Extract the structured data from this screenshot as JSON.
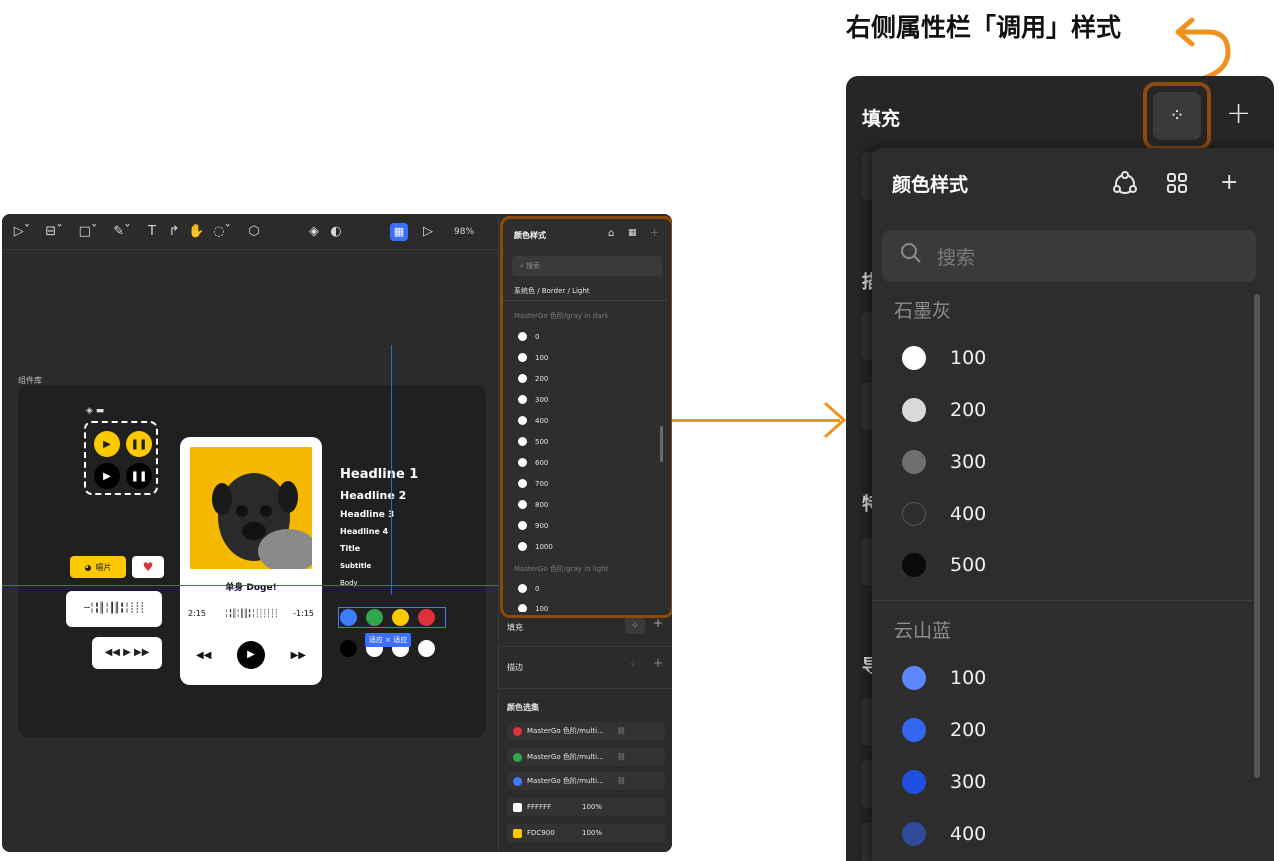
{
  "caption": {
    "text": "右侧属性栏「调用」样式"
  },
  "editor": {
    "toolbar": {
      "icons": [
        "cursor-icon",
        "frame-icon",
        "rect-icon",
        "pen-icon",
        "text-icon",
        "connector-icon",
        "hand-icon",
        "comment-icon",
        "plugin-icon",
        "component-icon",
        "contrast-icon",
        "grid-icon",
        "play-icon"
      ],
      "zoom": "98%"
    },
    "canvas": {
      "library_label": "组件库",
      "chip_label": "唱片",
      "song_title": "单身 Doge!",
      "time_start": "2:15",
      "time_end": "-1:15",
      "typography": [
        "Headline 1",
        "Headline 2",
        "Headline 3",
        "Headline 4",
        "Title",
        "Subtitle",
        "Body"
      ],
      "fit_tag": "适应 × 适应",
      "top_dots": [
        "#3d7bff",
        "#2ea84a",
        "#fdc900",
        "#e0303a"
      ],
      "bottom_dots": [
        "#000000",
        "#ffffff",
        "#ffffff",
        "#ffffff"
      ]
    },
    "popup": {
      "title": "颜色样式",
      "search_placeholder": "搜索",
      "category": "系统色 / Border / Light",
      "group1": "MasterGo 色阶/gray in dark",
      "items": [
        "0",
        "100",
        "200",
        "300",
        "400",
        "500",
        "600",
        "700",
        "800",
        "900",
        "1000"
      ],
      "group2": "MasterGo 色阶/gray in light",
      "items2": [
        "0",
        "100"
      ]
    },
    "panel": {
      "fill_label": "填充",
      "stroke_label": "描边",
      "selection_colors_label": "颜色选集",
      "styles": [
        {
          "name": "MasterGo 色阶/multi...",
          "color": "#e0303a"
        },
        {
          "name": "MasterGo 色阶/multi...",
          "color": "#2ea84a"
        },
        {
          "name": "MasterGo 色阶/multi...",
          "color": "#3d7bff"
        }
      ],
      "hex_rows": [
        {
          "hex": "FFFFFF",
          "opacity": "100%",
          "color": "#ffffff"
        },
        {
          "hex": "FDC900",
          "opacity": "100%",
          "color": "#fdc900"
        }
      ]
    }
  },
  "big_panel": {
    "fill_label": "填充",
    "popup_title": "颜色样式",
    "search_placeholder": "搜索",
    "groups": [
      {
        "name": "石墨灰",
        "items": [
          {
            "label": "100",
            "color": "#ffffff"
          },
          {
            "label": "200",
            "color": "#d9d9d9"
          },
          {
            "label": "300",
            "color": "#6e6e6e"
          },
          {
            "label": "400",
            "color": "#2d2d2d"
          },
          {
            "label": "500",
            "color": "#0a0a0a"
          }
        ]
      },
      {
        "name": "云山蓝",
        "items": [
          {
            "label": "100",
            "color": "#5a86ff"
          },
          {
            "label": "200",
            "color": "#3366ee"
          },
          {
            "label": "300",
            "color": "#1f4fe0"
          },
          {
            "label": "400",
            "color": "#2f4a99"
          }
        ]
      }
    ],
    "hidden_letters": [
      "描",
      "特",
      "导"
    ]
  },
  "accent_colors": {
    "orange": "#f0921e",
    "outline": "#8b4a0e"
  }
}
